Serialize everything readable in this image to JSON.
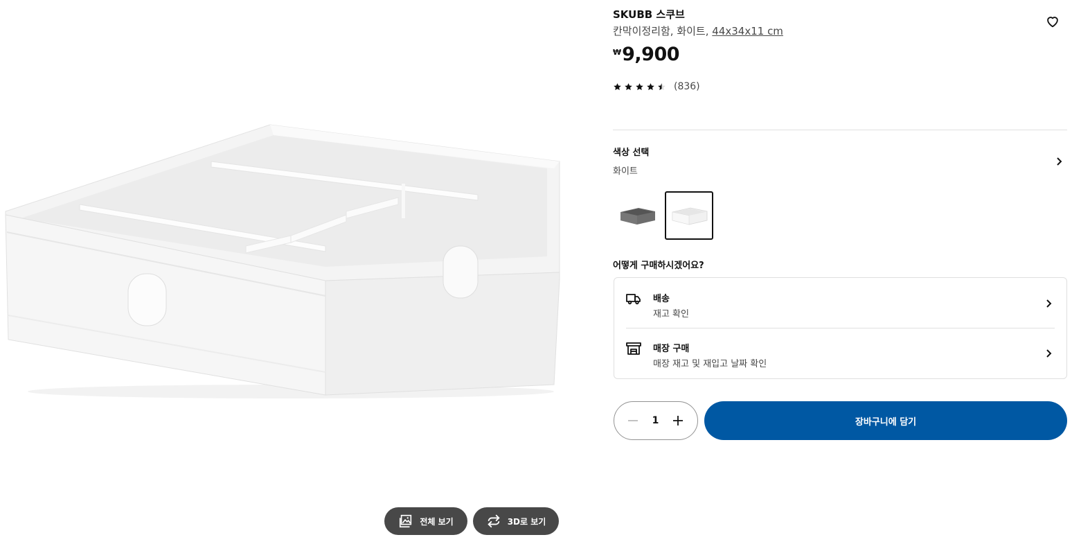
{
  "product": {
    "name": "SKUBB 스쿠브",
    "description_prefix": "칸막이정리함, 화이트, ",
    "dimensions": "44x34x11 cm",
    "currency_symbol": "₩",
    "price": "9,900",
    "rating_value": 4.5,
    "rating_max": 5,
    "review_count": "(836)"
  },
  "color": {
    "label": "색상 선택",
    "selected": "화이트",
    "swatches": [
      "gray",
      "white"
    ]
  },
  "purchase": {
    "question": "어떻게 구매하시겠어요?",
    "options": [
      {
        "title": "배송",
        "subtitle": "재고 확인",
        "icon": "truck-icon"
      },
      {
        "title": "매장 구매",
        "subtitle": "매장 재고 및 재입고 날짜 확인",
        "icon": "store-icon"
      }
    ],
    "quantity": "1",
    "add_to_cart": "장바구니에 담기"
  },
  "media": {
    "full_view": "전체 보기",
    "view_3d": "3D로 보기"
  },
  "colors": {
    "primary": "#0058a3",
    "media_button": "#484848",
    "border": "#dfdfdf"
  }
}
